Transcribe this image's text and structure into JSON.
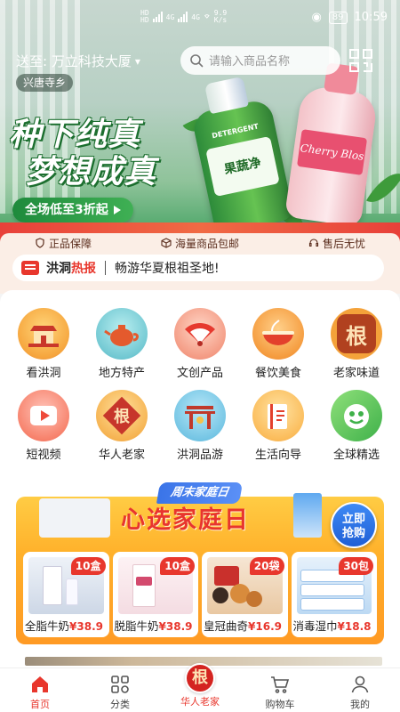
{
  "status_bar": {
    "network_a": "HD",
    "network_b": "4G",
    "network_c": "HD",
    "network_d": "4G",
    "speed_value": "9.9",
    "speed_unit": "K/s",
    "battery": "89",
    "time": "10:59"
  },
  "header": {
    "delivery_to": "送至: 万立科技大厦",
    "town": "兴唐寺乡",
    "search_placeholder": "请输入商品名称"
  },
  "banner": {
    "slogan_line1": "种下纯真",
    "slogan_line2": "梦想成真",
    "promo": "全场低至3折起",
    "product1_label": "果蔬净",
    "product1_brand": "DETERGENT",
    "product2_label": "Cherry Blos"
  },
  "assurances": [
    "正品保障",
    "海量商品包邮",
    "售后无忧"
  ],
  "news": {
    "tag_a": "洪洞",
    "tag_b": "热报",
    "message": "畅游华夏根祖圣地!"
  },
  "categories": [
    {
      "label": "看洪洞",
      "icon": "temple-icon"
    },
    {
      "label": "地方特产",
      "icon": "teapot-icon"
    },
    {
      "label": "文创产品",
      "icon": "fan-icon"
    },
    {
      "label": "餐饮美食",
      "icon": "noodle-bowl-icon"
    },
    {
      "label": "老家味道",
      "icon": "root-character-icon",
      "glyph": "根"
    },
    {
      "label": "短视频",
      "icon": "video-play-icon"
    },
    {
      "label": "华人老家",
      "icon": "root-emblem-icon",
      "glyph": "根"
    },
    {
      "label": "洪洞品游",
      "icon": "gate-icon"
    },
    {
      "label": "生活向导",
      "icon": "guide-book-icon"
    },
    {
      "label": "全球精选",
      "icon": "global-select-icon"
    }
  ],
  "weekend_promo": {
    "tag": "周末家庭日",
    "title": "心选家庭日",
    "buy_line1": "立即",
    "buy_line2": "抢购",
    "products": [
      {
        "name": "全脂牛奶",
        "price": "¥38.9",
        "qty": "10盒"
      },
      {
        "name": "脱脂牛奶",
        "price": "¥38.9",
        "qty": "10盒"
      },
      {
        "name": "皇冠曲奇",
        "price": "¥16.9",
        "qty": "20袋"
      },
      {
        "name": "消毒湿巾",
        "price": "¥18.8",
        "qty": "30包"
      }
    ]
  },
  "tabbar": {
    "items": [
      {
        "label": "首页",
        "icon": "home-icon",
        "active": true
      },
      {
        "label": "分类",
        "icon": "category-grid-icon"
      },
      {
        "label": "华人老家",
        "icon": "brand-logo-icon",
        "glyph": "根"
      },
      {
        "label": "购物车",
        "icon": "cart-icon"
      },
      {
        "label": "我的",
        "icon": "profile-icon"
      }
    ]
  },
  "colors": {
    "brand_red": "#e8372d",
    "promo_orange": "#ffb02a",
    "slogan_green": "#1e8a3c"
  }
}
